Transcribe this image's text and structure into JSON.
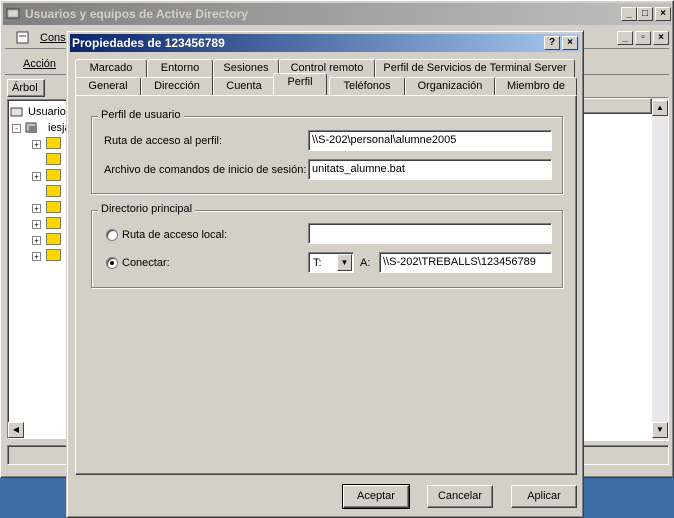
{
  "background_window": {
    "title": "Usuarios y equipos de Active Directory",
    "menu": {
      "console": "Consola",
      "action": "Acción"
    },
    "tree_tab": "Árbol",
    "tree": {
      "root": "Usuarios",
      "domain": "iesja"
    }
  },
  "dialog": {
    "title": "Propiedades de 123456789",
    "help_button": "?",
    "close_button": "×",
    "tabs_row1": [
      "Marcado",
      "Entorno",
      "Sesiones",
      "Control remoto",
      "Perfil de Servicios de Terminal Server"
    ],
    "tabs_row2": [
      "General",
      "Dirección",
      "Cuenta",
      "Perfil",
      "Teléfonos",
      "Organización",
      "Miembro de"
    ],
    "selected_tab": "Perfil",
    "profile_group": {
      "legend": "Perfil de usuario",
      "profile_path_label": "Ruta de acceso al perfil:",
      "profile_path_value": "\\\\S-202\\personal\\alumne2005",
      "logon_script_label": "Archivo de comandos de inicio de sesión:",
      "logon_script_value": "unitats_alumne.bat"
    },
    "home_group": {
      "legend": "Directorio principal",
      "local_path_label": "Ruta de acceso local:",
      "local_path_value": "",
      "connect_label": "Conectar:",
      "drive_value": "T:",
      "to_label": "A:",
      "connect_path_value": "\\\\S-202\\TREBALLS\\123456789",
      "selected_option": "connect"
    },
    "buttons": {
      "ok": "Aceptar",
      "cancel": "Cancelar",
      "apply": "Aplicar"
    }
  },
  "colors": {
    "desktop": "#3a6ea5",
    "active_title_start": "#0a246a",
    "active_title_end": "#a6caf0",
    "inactive_title": "#808080",
    "face": "#d4d0c8"
  }
}
